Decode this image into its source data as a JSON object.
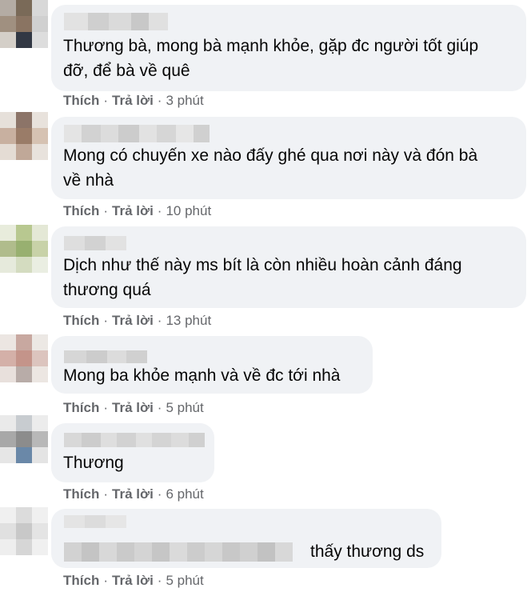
{
  "actions": {
    "like": "Thích",
    "reply": "Trả lời",
    "separator": "·"
  },
  "comments": [
    {
      "text": "Thương bà, mong bà mạnh khỏe, gặp đc người tốt giúp\nđỡ, để bà về quê",
      "time": "3 phút"
    },
    {
      "text": "Mong có chuyến xe nào đấy ghé qua nơi này và đón bà\nvề nhà",
      "time": "10 phút"
    },
    {
      "text": "Dịch như thế này ms bít là còn nhiều hoàn cảnh đáng\nthương quá",
      "time": "13 phút"
    },
    {
      "text": "Mong ba khỏe mạnh và về đc tới nhà",
      "time": "5 phút"
    },
    {
      "text": "Thương",
      "time": "6 phút"
    },
    {
      "text": "thấy thương ds",
      "time": "5 phút"
    }
  ],
  "colors": {
    "bubble": "#f0f2f5",
    "text": "#050505",
    "meta": "#65676b"
  }
}
